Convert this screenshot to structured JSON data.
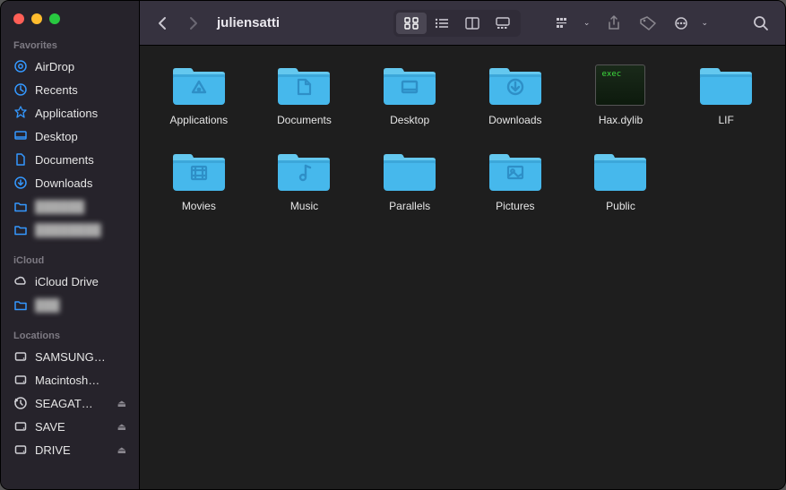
{
  "window_title": "juliensatti",
  "sidebar": {
    "sections": [
      {
        "header": "Favorites",
        "items": [
          {
            "label": "AirDrop",
            "icon": "airdrop",
            "color": "#3498ff"
          },
          {
            "label": "Recents",
            "icon": "clock",
            "color": "#3498ff"
          },
          {
            "label": "Applications",
            "icon": "appgrid",
            "color": "#3498ff"
          },
          {
            "label": "Desktop",
            "icon": "desktop",
            "color": "#3498ff"
          },
          {
            "label": "Documents",
            "icon": "doc",
            "color": "#3498ff"
          },
          {
            "label": "Downloads",
            "icon": "download",
            "color": "#3498ff"
          },
          {
            "label": "██████",
            "icon": "folder",
            "color": "#3498ff",
            "blur": true
          },
          {
            "label": "████████",
            "icon": "folder",
            "color": "#3498ff",
            "blur": true
          }
        ]
      },
      {
        "header": "iCloud",
        "items": [
          {
            "label": "iCloud Drive",
            "icon": "cloud",
            "color": "#cfcfd4"
          },
          {
            "label": "███",
            "icon": "folder",
            "color": "#3498ff",
            "blur": true
          }
        ]
      },
      {
        "header": "Locations",
        "items": [
          {
            "label": "SAMSUNG…",
            "icon": "disk",
            "color": "#cfcfd4"
          },
          {
            "label": "Macintosh…",
            "icon": "disk",
            "color": "#cfcfd4"
          },
          {
            "label": "SEAGAT…",
            "icon": "timemachine",
            "color": "#cfcfd4",
            "eject": true
          },
          {
            "label": "SAVE",
            "icon": "disk",
            "color": "#cfcfd4",
            "eject": true
          },
          {
            "label": "DRIVE",
            "icon": "disk",
            "color": "#cfcfd4",
            "eject": true
          }
        ]
      }
    ]
  },
  "files": [
    {
      "name": "Applications",
      "type": "folder",
      "glyph": "app"
    },
    {
      "name": "Documents",
      "type": "folder",
      "glyph": "doc"
    },
    {
      "name": "Desktop",
      "type": "folder",
      "glyph": "desktop"
    },
    {
      "name": "Downloads",
      "type": "folder",
      "glyph": "download"
    },
    {
      "name": "Hax.dylib",
      "type": "exec",
      "exec_label": "exec"
    },
    {
      "name": "LIF",
      "type": "folder",
      "glyph": "plain"
    },
    {
      "name": "Movies",
      "type": "folder",
      "glyph": "movie"
    },
    {
      "name": "Music",
      "type": "folder",
      "glyph": "music"
    },
    {
      "name": "Parallels",
      "type": "folder",
      "glyph": "plain"
    },
    {
      "name": "Pictures",
      "type": "folder",
      "glyph": "picture"
    },
    {
      "name": "Public",
      "type": "folder",
      "glyph": "plain"
    }
  ],
  "toolbar": {
    "views": [
      "icon",
      "list",
      "column",
      "gallery"
    ],
    "active_view": "icon"
  }
}
